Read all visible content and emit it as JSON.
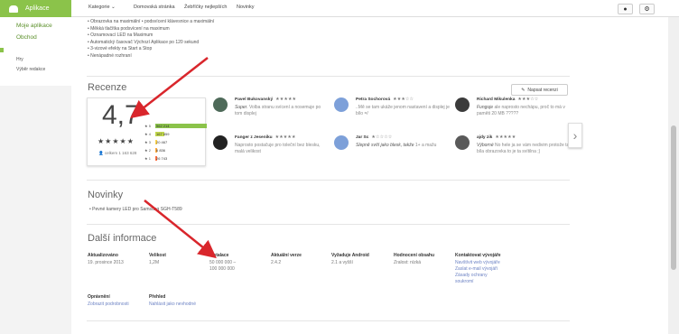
{
  "header": {
    "apps_label": "Aplikace",
    "nav": [
      "Kategorie",
      "Domovská stránka",
      "Žebříčky nejlepších",
      "Novinky"
    ],
    "help_icon": "help-icon",
    "settings_icon": "gear-icon"
  },
  "sidebar": {
    "my_apps": "Moje aplikace",
    "store": "Obchod",
    "games": "Hry",
    "editors": "Výběr redakce"
  },
  "features": [
    "• Obrazovka na maximální • podsvícení klávesnice a maximální",
    "• Měkká tlačítka podsvícení na maximum",
    "• Oznamovací LED na Maximum",
    "• Automatický časovač Výchozí Aplikace po 120 sekund",
    "• 3-vizové efekty na Start a Stop",
    "• Nenápadné rozhraní"
  ],
  "reviews_section": {
    "title": "Recenze",
    "write_button": "Napsat recenzi",
    "score": "4,7",
    "stars": "★★★★★",
    "total": "celkem 1 163 628",
    "distribution": [
      {
        "label": "★ 5",
        "value": "962 214",
        "fraction": 1.0,
        "color": "#8bc34a"
      },
      {
        "label": "★ 4",
        "value": "167 859",
        "fraction": 0.18,
        "color": "#c3d94e"
      },
      {
        "label": "★ 3",
        "value": "20 467",
        "fraction": 0.03,
        "color": "#ffd54f"
      },
      {
        "label": "★ 2",
        "value": "6 836",
        "fraction": 0.01,
        "color": "#ffab40"
      },
      {
        "label": "★ 1",
        "value": "26 743",
        "fraction": 0.03,
        "color": "#ff7043"
      }
    ],
    "reviews": [
      {
        "name": "Pavel Bukovanský",
        "stars": "★★★★★",
        "bold": "Super.",
        "text": "Volba stranu svícení a nosemuje po tom displej"
      },
      {
        "name": "Petra Sochorová",
        "stars": "★★★☆☆",
        "bold": "",
        "text": "..Mě se tam ukáže jenom nastavení a displej je bílo =/"
      },
      {
        "name": "Richard Mikulenka",
        "stars": "★★★☆☆",
        "bold": "Funguje",
        "text": "ale naprosto nechápu, proč to má v paměti 20 MB ?????"
      },
      {
        "name": "Fanger z Jeseníku",
        "stars": "★★★★★",
        "bold": "",
        "text": "Naprosto postačuje pro toleční bez blesku, malá velikost"
      },
      {
        "name": "Jar Sc",
        "stars": "★☆☆☆☆",
        "bold": "Slepně svítí jako blesk, takže",
        "text": "1+ a mažu"
      },
      {
        "name": "ajdy zik",
        "stars": "★★★★★",
        "bold": "Výborné",
        "text": "No hele ja se vám nedivim protože ta bíla obrazovka to je ta svítilna ;)"
      }
    ]
  },
  "news": {
    "title": "Novinky",
    "item": "• Pevné kamery LED pro Samsung SGH-T589"
  },
  "additional": {
    "title": "Další informace",
    "updated_label": "Aktualizováno",
    "updated_value": "19. prosince 2013",
    "size_label": "Velikost",
    "size_value": "1,2M",
    "installs_label": "Instalace",
    "installs_value_1": "50 000 000 –",
    "installs_value_2": "100 000 000",
    "version_label": "Aktuální verze",
    "version_value": "2.4.2",
    "android_label": "Vyžaduje Android",
    "android_value": "2.1 a vyšší",
    "content_label": "Hodnocení obsahu",
    "content_value": "Zralost: nízká",
    "contact_label": "Kontaktovat vývojáře",
    "contact_links": [
      "Navštívit web vývojáře",
      "Zaslat e-mail vývojáři",
      "Zásady ochrany",
      "soukromí"
    ],
    "permissions_label": "Oprávnění",
    "permissions_link": "Zobrazit podrobnosti",
    "report_label": "Přehled",
    "report_link": "Nahlásit jako nevhodné"
  },
  "colors": {
    "accent": "#8bc34a",
    "arrow": "#d9262c",
    "link": "#6d83c4"
  }
}
